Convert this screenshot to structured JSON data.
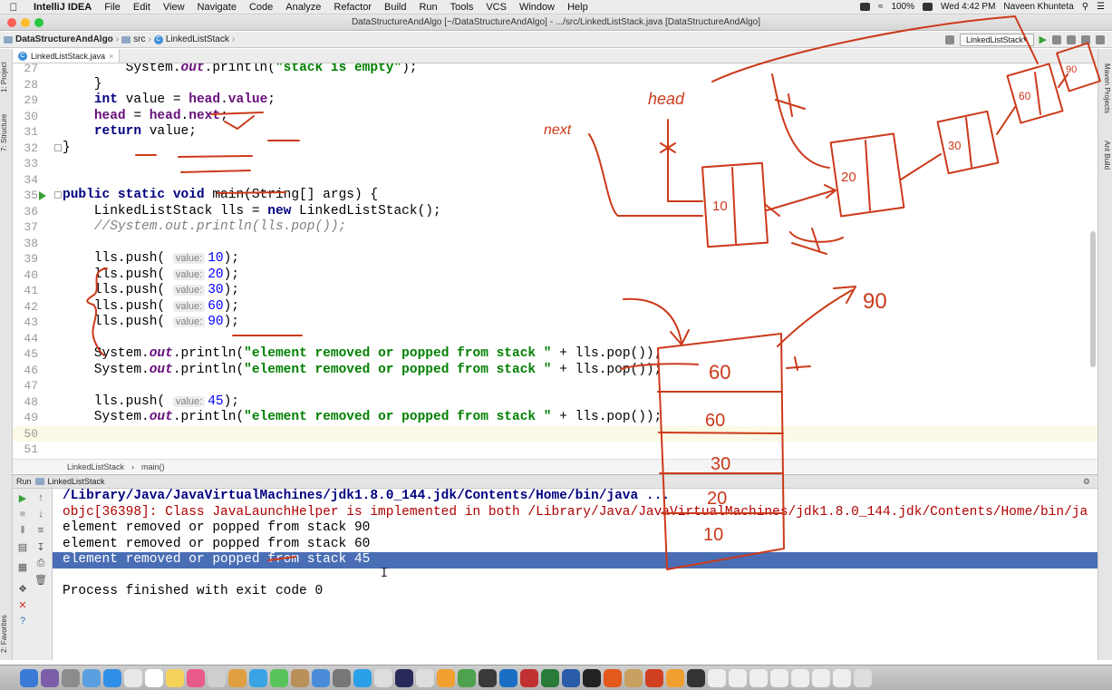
{
  "menubar": {
    "app": "IntelliJ IDEA",
    "items": [
      "File",
      "Edit",
      "View",
      "Navigate",
      "Code",
      "Analyze",
      "Refactor",
      "Build",
      "Run",
      "Tools",
      "VCS",
      "Window",
      "Help"
    ],
    "battery": "100%",
    "clock": "Wed 4:42 PM",
    "user": "Naveen Khunteta"
  },
  "window": {
    "title": "DataStructureAndAlgo [~/DataStructureAndAlgo] - .../src/LinkedListStack.java [DataStructureAndAlgo]"
  },
  "navbar": {
    "crumbs": [
      "DataStructureAndAlgo",
      "src",
      "LinkedListStack"
    ],
    "run_config": "LinkedListStack"
  },
  "left_tools": [
    "1: Project",
    "7: Structure",
    "2: Favorites"
  ],
  "right_tools": [
    "Maven Projects",
    "Ant Build"
  ],
  "tab": {
    "name": "LinkedListStack.java"
  },
  "editor_crumbs": [
    "LinkedListStack",
    "main()"
  ],
  "run_panel": {
    "label": "Run",
    "config": "LinkedListStack"
  },
  "console": [
    {
      "text": "/Library/Java/JavaVirtualMachines/jdk1.8.0_144.jdk/Contents/Home/bin/java ...",
      "kind": "path"
    },
    {
      "text": "objc[36398]: Class JavaLaunchHelper is implemented in both /Library/Java/JavaVirtualMachines/jdk1.8.0_144.jdk/Contents/Home/bin/ja",
      "kind": "err"
    },
    {
      "text": "element removed or popped from stack 90",
      "kind": "out"
    },
    {
      "text": "element removed or popped from stack 60",
      "kind": "out"
    },
    {
      "text": "element removed or popped from stack 45",
      "kind": "sel"
    },
    {
      "text": "",
      "kind": "out"
    },
    {
      "text": "Process finished with exit code 0",
      "kind": "out"
    }
  ],
  "annotations": {
    "head": "head",
    "next": "next",
    "node1": "10",
    "node2": "20",
    "node3": "30",
    "node4": "60",
    "gone": "90",
    "stack": [
      "60",
      "60",
      "30",
      "20",
      "10"
    ],
    "arrow_label": "90"
  }
}
